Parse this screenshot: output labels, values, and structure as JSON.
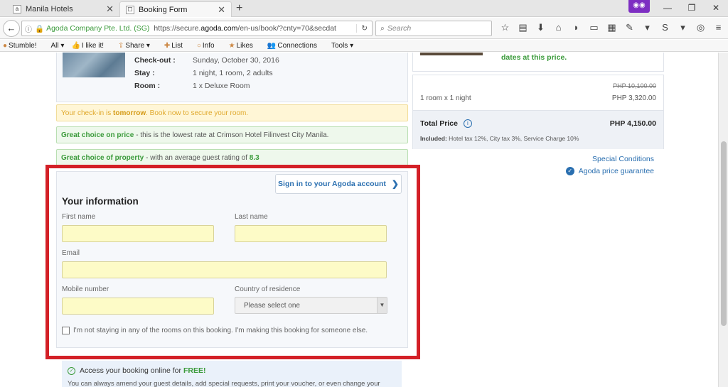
{
  "browser": {
    "tabs": [
      {
        "title": "Manila Hotels",
        "active": false
      },
      {
        "title": "Booking Form",
        "active": true
      }
    ],
    "new_tab": "+",
    "url_org": "Agoda Company Pte. Ltd. (SG)",
    "url_prefix": "https://secure.",
    "url_host": "agoda.com",
    "url_path": "/en-us/book/?cnty=70&secdat",
    "search_placeholder": "Search",
    "bookmarks": [
      "Stumble!",
      "All ▾",
      "I like it!",
      "Share ▾",
      "List",
      "Info",
      "Likes",
      "Connections",
      "Tools ▾"
    ]
  },
  "summary": {
    "checkout_label": "Check-out :",
    "checkout_value": "Sunday, October 30, 2016",
    "stay_label": "Stay :",
    "stay_value": "1 night, 1 room, 2 adults",
    "room_label": "Room :",
    "room_value": "1 x Deluxe Room"
  },
  "notices": {
    "checkin_pre": "Your check-in is ",
    "checkin_bold": "tomorrow",
    "checkin_post": ". Book now to secure your room.",
    "price_bold": "Great choice on price",
    "price_text": "- this is the lowest rate at Crimson Hotel Filinvest City Manila.",
    "property_bold": "Great choice of property",
    "property_text": "- with an average guest rating of ",
    "property_rating": "8.3"
  },
  "form": {
    "signin_label": "Sign in to your Agoda account",
    "title": "Your information",
    "first_name_label": "First name",
    "last_name_label": "Last name",
    "email_label": "Email",
    "mobile_label": "Mobile number",
    "country_label": "Country of residence",
    "country_value": "Please select one",
    "someone_else_label": "I'm not staying in any of the rooms on this booking. I'm making this booking for someone else."
  },
  "access": {
    "title": "Access your booking online for",
    "free": "FREE!",
    "desc": "You can always amend your guest details, add special requests, print your voucher, or even change your"
  },
  "price": {
    "dates_text": "dates at this price.",
    "old_price": "PHP 10,100.00",
    "rooms_label": "1 room x 1 night",
    "room_price": "PHP 3,320.00",
    "total_label": "Total Price",
    "total_value": "PHP 4,150.00",
    "included_label": "Included:",
    "included_text": " Hotel tax 12%, City tax 3%, Service Charge 10%",
    "special_conditions": "Special Conditions",
    "guarantee": "Agoda price guarantee"
  },
  "colors": {
    "highlight": "#d32027",
    "agoda_blue": "#2a6fb0",
    "green": "#3a9a3a",
    "input_yellow": "#fdfbc7"
  }
}
